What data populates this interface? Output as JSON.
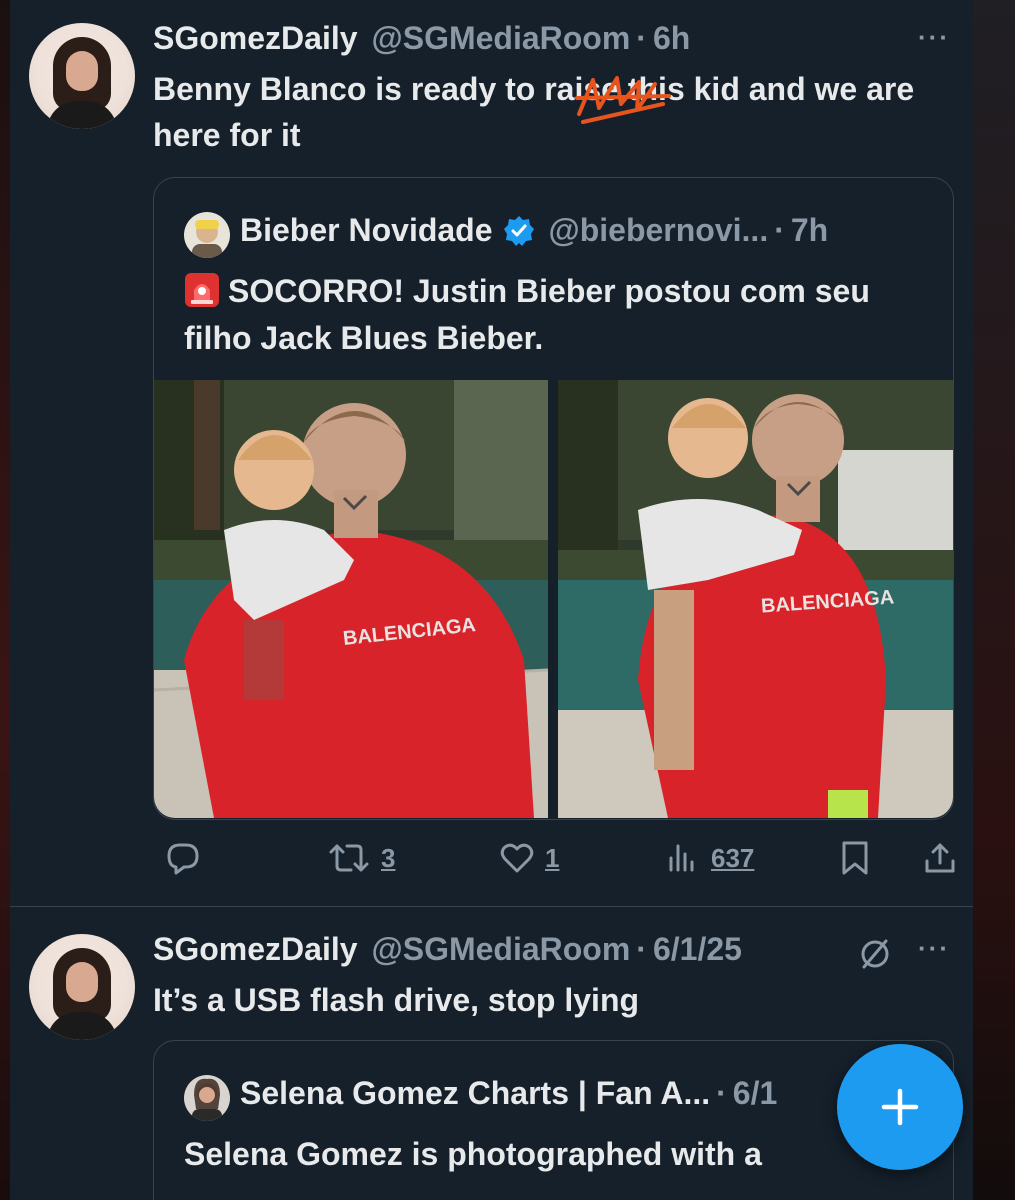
{
  "tweets": [
    {
      "author_name": "SGomezDaily",
      "author_handle": "@SGMediaRoom",
      "separator": "·",
      "time": "6h",
      "more_label": "···",
      "text_before": "Benny Blanco is ready to ",
      "text_struck": "raise",
      "text_after": " this kid and we are here for it",
      "quote": {
        "author_name": "Bieber Novidade",
        "author_handle": "@biebernovi...",
        "separator": "·",
        "time": "7h",
        "verified": true,
        "text": "SOCORRO! Justin Bieber postou com seu filho Jack Blues Bieber.",
        "emoji_icon": "police-siren-icon",
        "photos": [
          {
            "shirt_text": "BALENCIAGA"
          },
          {
            "shirt_text": "BALENCIAGA"
          }
        ]
      },
      "actions": {
        "reply": {
          "icon": "reply-icon",
          "count": ""
        },
        "retweet": {
          "icon": "retweet-icon",
          "count": "3"
        },
        "like": {
          "icon": "heart-icon",
          "count": "1"
        },
        "views": {
          "icon": "views-chart-icon",
          "count": "637"
        },
        "bookmark": {
          "icon": "bookmark-icon"
        },
        "share": {
          "icon": "share-icon"
        }
      }
    },
    {
      "author_name": "SGomezDaily",
      "author_handle": "@SGMediaRoom",
      "separator": "·",
      "time": "6/1/25",
      "more_label": "···",
      "text": "It’s a USB flash drive, stop lying",
      "status_icon": "no-entry-icon",
      "quote": {
        "author_name": "Selena Gomez Charts | Fan A...",
        "separator": "·",
        "time": "6/1",
        "text": "Selena Gomez is photographed with a"
      }
    }
  ],
  "fab": {
    "icon": "plus-icon",
    "label": "+"
  },
  "colors": {
    "background": "#15202b",
    "text": "#e7e9ea",
    "muted": "#8b98a5",
    "border": "#38444d",
    "accent": "#1d9bf0",
    "scribble": "#e8541e"
  }
}
